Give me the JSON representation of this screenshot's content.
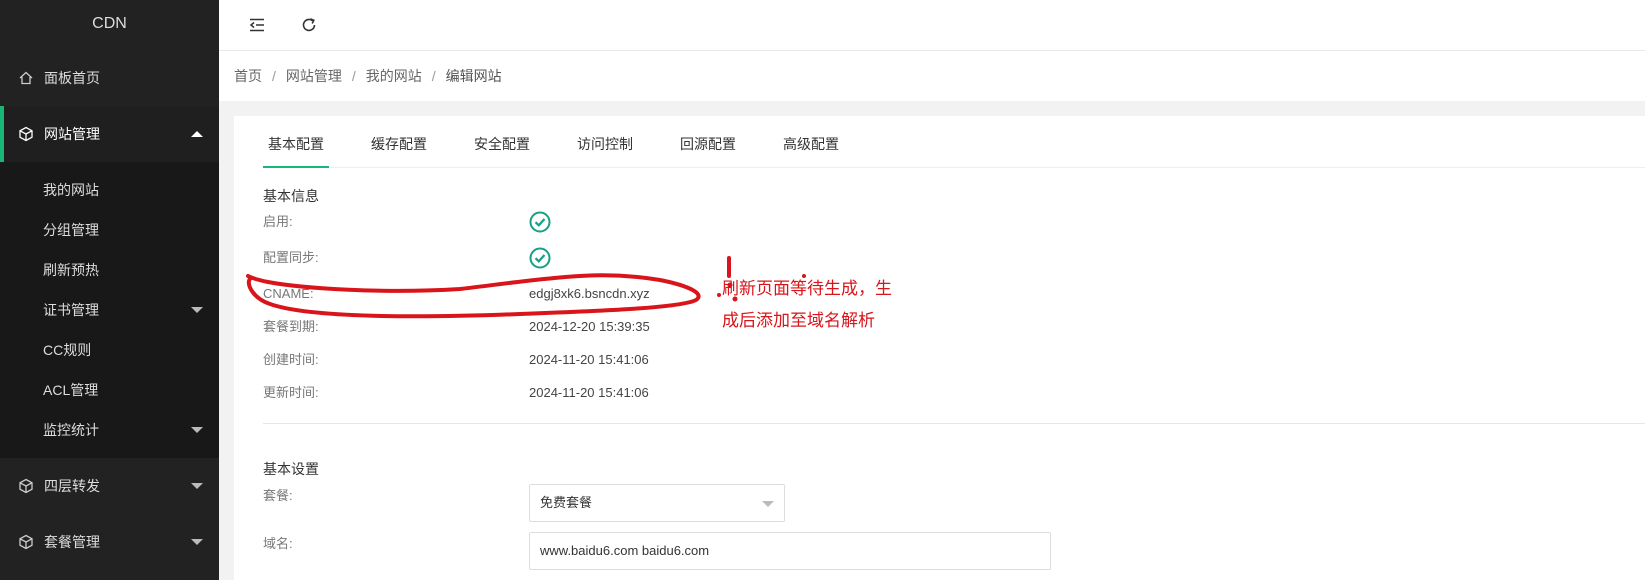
{
  "sidebar": {
    "logo": "CDN",
    "top_items": [
      {
        "label": "面板首页",
        "icon": "home-icon"
      },
      {
        "label": "网站管理",
        "icon": "cube-icon"
      },
      {
        "label": "四层转发",
        "icon": "cube-icon"
      },
      {
        "label": "套餐管理",
        "icon": "cube-icon"
      }
    ],
    "sub_items": [
      {
        "label": "我的网站"
      },
      {
        "label": "分组管理"
      },
      {
        "label": "刷新预热"
      },
      {
        "label": "证书管理"
      },
      {
        "label": "CC规则"
      },
      {
        "label": "ACL管理"
      },
      {
        "label": "监控统计"
      }
    ]
  },
  "header": {
    "menu_toggle_icon": "indent-icon",
    "refresh_icon": "refresh-icon"
  },
  "breadcrumb": {
    "items": [
      "首页",
      "网站管理",
      "我的网站",
      "编辑网站"
    ],
    "separator": "/"
  },
  "tabs": [
    "基本配置",
    "缓存配置",
    "安全配置",
    "访问控制",
    "回源配置",
    "高级配置"
  ],
  "basic_info": {
    "title": "基本信息",
    "enabled_label": "启用:",
    "sync_label": "配置同步:",
    "cname_label": "CNAME:",
    "cname_value": "edgj8xk6.bsncdn.xyz",
    "expire_label": "套餐到期:",
    "expire_value": "2024-12-20 15:39:35",
    "created_label": "创建时间:",
    "created_value": "2024-11-20 15:41:06",
    "updated_label": "更新时间:",
    "updated_value": "2024-11-20 15:41:06"
  },
  "basic_settings": {
    "title": "基本设置",
    "plan_label": "套餐:",
    "plan_value": "免费套餐",
    "domain_label": "域名:",
    "domain_value": "www.baidu6.com baidu6.com"
  },
  "annotation": {
    "line1": "刷新页面等待生成，生",
    "line2": "成后添加至域名解析"
  },
  "colors": {
    "accent": "#16b777",
    "sidebar_bg": "#222222",
    "annotation_red": "#d9141a"
  }
}
